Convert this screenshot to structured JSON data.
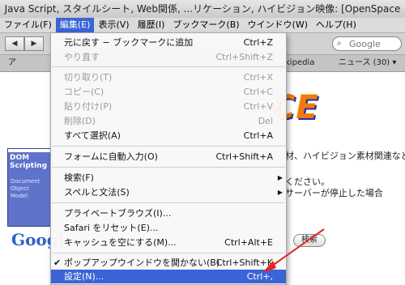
{
  "window": {
    "title": "Java Script, スタイルシート, Web関係, ...リケーション, ハイビジョン映像: [OpenSpace"
  },
  "menubar": {
    "items": [
      "ファイル(F)",
      "編集(E)",
      "表示(V)",
      "履歴(I)",
      "ブックマーク(B)",
      "ウインドウ(W)",
      "ヘルプ(H)"
    ]
  },
  "toolbar": {
    "back_glyph": "◀",
    "forward_glyph": "▶",
    "search_placeholder": "Google"
  },
  "bookmarks": {
    "left": "ア",
    "mid": "kipedia",
    "right": "ニュース (30) ▾"
  },
  "page": {
    "logo": "CE",
    "line1": "材、ハイビジョン素材関連など",
    "line2": "ください。",
    "line3": "サーバーが停止した場合",
    "book_title": "DOM\nScripting",
    "book_sub": "Document\nObject\nModel",
    "google_a": "Goog",
    "google_b": "l",
    "search_button": "検索"
  },
  "edit_menu": {
    "items": [
      {
        "label": "元に戻す − ブックマークに追加",
        "shortcut": "Ctrl+Z",
        "disabled": false
      },
      {
        "label": "やり直す",
        "shortcut": "Ctrl+Shift+Z",
        "disabled": true
      },
      {
        "label": "切り取り(T)",
        "shortcut": "Ctrl+X",
        "disabled": true
      },
      {
        "label": "コピー(C)",
        "shortcut": "Ctrl+C",
        "disabled": true
      },
      {
        "label": "貼り付け(P)",
        "shortcut": "Ctrl+V",
        "disabled": true
      },
      {
        "label": "削除(D)",
        "shortcut": "Del",
        "disabled": true
      },
      {
        "label": "すべて選択(A)",
        "shortcut": "Ctrl+A",
        "disabled": false
      },
      {
        "label": "フォームに自動入力(O)",
        "shortcut": "Ctrl+Shift+A",
        "disabled": false
      },
      {
        "label": "検索(F)",
        "shortcut": "",
        "disabled": false,
        "submenu": true
      },
      {
        "label": "スペルと文法(S)",
        "shortcut": "",
        "disabled": false,
        "submenu": true
      },
      {
        "label": "プライベートブラウズ(I)...",
        "shortcut": "",
        "disabled": false
      },
      {
        "label": "Safari をリセット(E)...",
        "shortcut": "",
        "disabled": false
      },
      {
        "label": "キャッシュを空にする(M)...",
        "shortcut": "Ctrl+Alt+E",
        "disabled": false
      },
      {
        "label": "ポップアップウインドウを開かない(B)",
        "shortcut": "Ctrl+Shift+K",
        "disabled": false,
        "checked": true
      },
      {
        "label": "設定(N)...",
        "shortcut": "Ctrl+,",
        "disabled": false,
        "selected": true
      }
    ],
    "check_glyph": "✔",
    "submenu_glyph": "▶"
  },
  "colors": {
    "highlight": "#3b64d6",
    "arrow": "#e0261e"
  }
}
